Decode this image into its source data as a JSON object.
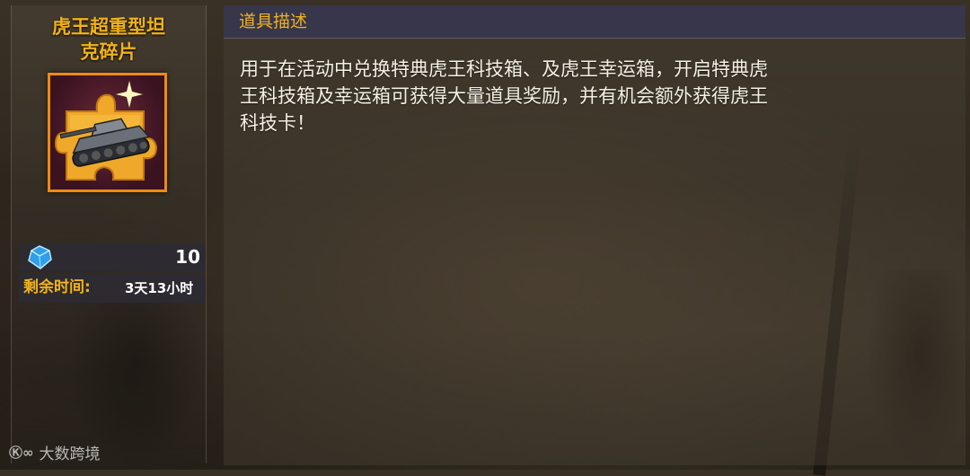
{
  "item": {
    "name_line1": "虎王超重型坦",
    "name_line2": "克碎片",
    "icon": "tank-puzzle-piece-icon"
  },
  "currency": {
    "icon": "blue-gem-icon",
    "value": "10"
  },
  "remaining_time": {
    "label": "剩余时间:",
    "value": "3天13小时"
  },
  "description": {
    "title": "道具描述",
    "text_line1": "用于在活动中兑换特典虎王科技箱、及虎王幸运箱，开启特典虎",
    "text_line2": "王科技箱及幸运箱可获得大量道具奖励，并有机会额外获得虎王",
    "text_line3": "科技卡！"
  },
  "watermark": {
    "logo": "Ⓚ∞",
    "text": "大数跨境"
  },
  "colors": {
    "accent_gold": "#f2b21a",
    "icon_border": "#f08a10",
    "header_bg": "#37364a"
  }
}
